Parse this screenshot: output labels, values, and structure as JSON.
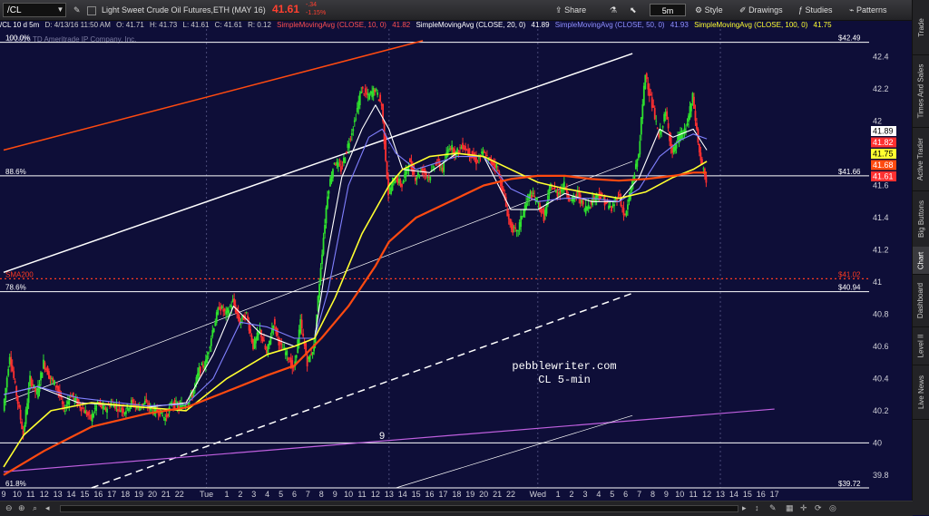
{
  "toolbar": {
    "symbol": "/CL",
    "description": "Light Sweet Crude Oil Futures,ETH (MAY 16)",
    "last_price": "41.61",
    "change_abs": "-.34",
    "change_pct": "-1.15%",
    "share": "Share",
    "timeframe": "5m",
    "style": "Style",
    "drawings": "Drawings",
    "studies": "Studies",
    "patterns": "Patterns"
  },
  "infobar": {
    "chart_id": "/CL 10 d 5m",
    "datetime": "D: 4/13/16 11:50 AM",
    "open": "O: 41.71",
    "high": "H: 41.73",
    "low": "L: 41.61",
    "close": "C: 41.61",
    "range": "R: 0.12",
    "sma10": "SimpleMovingAvg (CLOSE, 10, 0)",
    "sma10_val": "41.82",
    "sma20": "SimpleMovingAvg (CLOSE, 20, 0)",
    "sma20_val": "41.89",
    "sma50": "SimpleMovingAvg (CLOSE, 50, 0)",
    "sma50_val": "41.93",
    "sma100": "SimpleMovingAvg (CLOSE, 100, 0)",
    "sma100_val": "41.75"
  },
  "sidebar_tabs": [
    "Trade",
    "Times And Sales",
    "Active Trader",
    "Big Buttons",
    "Chart",
    "Dashboard",
    "Level II",
    "Live News"
  ],
  "colors": {
    "background": "#0e0e38",
    "sma10": "#ffffff",
    "sma20": "#8080ff",
    "sma50": "#ffff30",
    "sma100": "#ff4a10",
    "sma200": "#ff3a20",
    "fib": "#ffffff",
    "purple_line": "#c060e0",
    "candle_up": "#2ee02e",
    "candle_down": "#ff3030"
  },
  "chart_data": {
    "type": "line",
    "title": "",
    "watermark": "© 2016 TD Ameritrade IP Company, Inc.",
    "annotation_lines": [
      "pebblewriter.com",
      "CL 5-min"
    ],
    "label_9": "9",
    "yaxis": {
      "range": [
        39.72,
        42.55
      ],
      "ticks": [
        "39.8",
        "40",
        "40.2",
        "40.4",
        "40.6",
        "40.8",
        "41",
        "41.2",
        "41.4",
        "41.6",
        "41.8",
        "42",
        "42.2",
        "42.4"
      ]
    },
    "xaxis": {
      "range": [
        9,
        137
      ],
      "ticks": [
        {
          "x": 9,
          "label": "9"
        },
        {
          "x": 11,
          "label": "10"
        },
        {
          "x": 13,
          "label": "11"
        },
        {
          "x": 15,
          "label": "12"
        },
        {
          "x": 17,
          "label": "13"
        },
        {
          "x": 19,
          "label": "14"
        },
        {
          "x": 21,
          "label": "15"
        },
        {
          "x": 23,
          "label": "16"
        },
        {
          "x": 25,
          "label": "17"
        },
        {
          "x": 27,
          "label": "18"
        },
        {
          "x": 29,
          "label": "19"
        },
        {
          "x": 31,
          "label": "20"
        },
        {
          "x": 33,
          "label": "21"
        },
        {
          "x": 35,
          "label": "22"
        },
        {
          "x": 39,
          "label": "Tue"
        },
        {
          "x": 42,
          "label": "1"
        },
        {
          "x": 44,
          "label": "2"
        },
        {
          "x": 46,
          "label": "3"
        },
        {
          "x": 48,
          "label": "4"
        },
        {
          "x": 50,
          "label": "5"
        },
        {
          "x": 52,
          "label": "6"
        },
        {
          "x": 54,
          "label": "7"
        },
        {
          "x": 56,
          "label": "8"
        },
        {
          "x": 58,
          "label": "9"
        },
        {
          "x": 60,
          "label": "10"
        },
        {
          "x": 62,
          "label": "11"
        },
        {
          "x": 64,
          "label": "12"
        },
        {
          "x": 66,
          "label": "13"
        },
        {
          "x": 68,
          "label": "14"
        },
        {
          "x": 70,
          "label": "15"
        },
        {
          "x": 72,
          "label": "16"
        },
        {
          "x": 74,
          "label": "17"
        },
        {
          "x": 76,
          "label": "18"
        },
        {
          "x": 78,
          "label": "19"
        },
        {
          "x": 80,
          "label": "20"
        },
        {
          "x": 82,
          "label": "21"
        },
        {
          "x": 84,
          "label": "22"
        },
        {
          "x": 88,
          "label": "Wed"
        },
        {
          "x": 91,
          "label": "1"
        },
        {
          "x": 93,
          "label": "2"
        },
        {
          "x": 95,
          "label": "3"
        },
        {
          "x": 97,
          "label": "4"
        },
        {
          "x": 99,
          "label": "5"
        },
        {
          "x": 101,
          "label": "6"
        },
        {
          "x": 103,
          "label": "7"
        },
        {
          "x": 105,
          "label": "8"
        },
        {
          "x": 107,
          "label": "9"
        },
        {
          "x": 109,
          "label": "10"
        },
        {
          "x": 111,
          "label": "11"
        },
        {
          "x": 113,
          "label": "12"
        },
        {
          "x": 115,
          "label": "13"
        },
        {
          "x": 117,
          "label": "14"
        },
        {
          "x": 119,
          "label": "15"
        },
        {
          "x": 121,
          "label": "16"
        },
        {
          "x": 123,
          "label": "17"
        }
      ],
      "session_breaks": [
        39,
        66,
        88
      ],
      "future_breaks": [
        115
      ]
    },
    "price_path": [
      [
        9,
        40.2
      ],
      [
        10,
        40.55
      ],
      [
        11,
        40.3
      ],
      [
        12,
        40.05
      ],
      [
        13,
        40.4
      ],
      [
        14,
        40.3
      ],
      [
        15,
        40.5
      ],
      [
        16,
        40.4
      ],
      [
        17,
        40.35
      ],
      [
        18,
        40.2
      ],
      [
        19,
        40.3
      ],
      [
        20,
        40.25
      ],
      [
        21,
        40.2
      ],
      [
        22,
        40.15
      ],
      [
        23,
        40.25
      ],
      [
        24,
        40.2
      ],
      [
        25,
        40.25
      ],
      [
        26,
        40.22
      ],
      [
        27,
        40.2
      ],
      [
        28,
        40.25
      ],
      [
        29,
        40.22
      ],
      [
        30,
        40.25
      ],
      [
        31,
        40.2
      ],
      [
        32,
        40.2
      ],
      [
        33,
        40.15
      ],
      [
        34,
        40.25
      ],
      [
        35,
        40.22
      ],
      [
        36,
        40.25
      ],
      [
        37,
        40.3
      ],
      [
        38,
        40.45
      ],
      [
        39,
        40.5
      ],
      [
        40,
        40.7
      ],
      [
        41,
        40.85
      ],
      [
        42,
        40.8
      ],
      [
        43,
        40.88
      ],
      [
        44,
        40.75
      ],
      [
        45,
        40.8
      ],
      [
        46,
        40.6
      ],
      [
        47,
        40.7
      ],
      [
        48,
        40.55
      ],
      [
        49,
        40.75
      ],
      [
        50,
        40.6
      ],
      [
        51,
        40.55
      ],
      [
        52,
        40.45
      ],
      [
        53,
        40.75
      ],
      [
        54,
        40.5
      ],
      [
        55,
        40.6
      ],
      [
        56,
        41.1
      ],
      [
        57,
        41.55
      ],
      [
        58,
        41.75
      ],
      [
        59,
        41.7
      ],
      [
        60,
        41.85
      ],
      [
        61,
        42.0
      ],
      [
        62,
        42.2
      ],
      [
        63,
        42.15
      ],
      [
        64,
        42.2
      ],
      [
        65,
        42.1
      ],
      [
        66,
        41.55
      ],
      [
        67,
        41.65
      ],
      [
        68,
        41.6
      ],
      [
        69,
        41.75
      ],
      [
        70,
        41.65
      ],
      [
        71,
        41.7
      ],
      [
        72,
        41.65
      ],
      [
        73,
        41.75
      ],
      [
        74,
        41.7
      ],
      [
        75,
        41.85
      ],
      [
        76,
        41.8
      ],
      [
        77,
        41.85
      ],
      [
        78,
        41.8
      ],
      [
        79,
        41.75
      ],
      [
        80,
        41.8
      ],
      [
        81,
        41.75
      ],
      [
        82,
        41.72
      ],
      [
        83,
        41.55
      ],
      [
        84,
        41.35
      ],
      [
        85,
        41.3
      ],
      [
        86,
        41.45
      ],
      [
        87,
        41.55
      ],
      [
        88,
        41.5
      ],
      [
        89,
        41.4
      ],
      [
        90,
        41.6
      ],
      [
        91,
        41.55
      ],
      [
        92,
        41.6
      ],
      [
        93,
        41.5
      ],
      [
        94,
        41.55
      ],
      [
        95,
        41.45
      ],
      [
        96,
        41.5
      ],
      [
        97,
        41.55
      ],
      [
        98,
        41.5
      ],
      [
        99,
        41.45
      ],
      [
        100,
        41.55
      ],
      [
        101,
        41.4
      ],
      [
        102,
        41.6
      ],
      [
        103,
        41.8
      ],
      [
        104,
        42.3
      ],
      [
        105,
        42.1
      ],
      [
        106,
        41.9
      ],
      [
        107,
        42.05
      ],
      [
        108,
        41.8
      ],
      [
        109,
        41.9
      ],
      [
        110,
        41.95
      ],
      [
        111,
        42.15
      ],
      [
        112,
        41.8
      ],
      [
        113,
        41.61
      ]
    ],
    "series": [
      {
        "name": "SimpleMovingAvg (CLOSE, 10, 0)",
        "color": "#ffffff",
        "points": [
          [
            9,
            40.3
          ],
          [
            14,
            40.35
          ],
          [
            20,
            40.25
          ],
          [
            30,
            40.22
          ],
          [
            36,
            40.25
          ],
          [
            40,
            40.55
          ],
          [
            43,
            40.85
          ],
          [
            47,
            40.68
          ],
          [
            52,
            40.6
          ],
          [
            55,
            40.65
          ],
          [
            57,
            41.2
          ],
          [
            59,
            41.65
          ],
          [
            62,
            41.95
          ],
          [
            64,
            42.1
          ],
          [
            66,
            41.95
          ],
          [
            68,
            41.7
          ],
          [
            72,
            41.68
          ],
          [
            76,
            41.8
          ],
          [
            80,
            41.78
          ],
          [
            84,
            41.45
          ],
          [
            88,
            41.45
          ],
          [
            92,
            41.55
          ],
          [
            96,
            41.5
          ],
          [
            100,
            41.5
          ],
          [
            103,
            41.65
          ],
          [
            106,
            41.95
          ],
          [
            108,
            41.9
          ],
          [
            111,
            41.95
          ],
          [
            113,
            41.82
          ]
        ]
      },
      {
        "name": "SimpleMovingAvg (CLOSE, 20, 0)",
        "color": "#8080ff",
        "points": [
          [
            9,
            40.3
          ],
          [
            14,
            40.35
          ],
          [
            20,
            40.28
          ],
          [
            30,
            40.23
          ],
          [
            36,
            40.24
          ],
          [
            40,
            40.4
          ],
          [
            44,
            40.75
          ],
          [
            48,
            40.72
          ],
          [
            52,
            40.65
          ],
          [
            55,
            40.65
          ],
          [
            57,
            40.95
          ],
          [
            60,
            41.6
          ],
          [
            63,
            41.9
          ],
          [
            65,
            41.95
          ],
          [
            67,
            41.8
          ],
          [
            70,
            41.7
          ],
          [
            76,
            41.78
          ],
          [
            80,
            41.78
          ],
          [
            84,
            41.58
          ],
          [
            88,
            41.5
          ],
          [
            92,
            41.52
          ],
          [
            96,
            41.52
          ],
          [
            100,
            41.5
          ],
          [
            103,
            41.58
          ],
          [
            106,
            41.78
          ],
          [
            109,
            41.88
          ],
          [
            111,
            41.92
          ],
          [
            113,
            41.89
          ]
        ]
      },
      {
        "name": "SimpleMovingAvg (CLOSE, 50, 0)",
        "color": "#ffff30",
        "points": [
          [
            9,
            39.85
          ],
          [
            12,
            40.05
          ],
          [
            16,
            40.2
          ],
          [
            22,
            40.25
          ],
          [
            30,
            40.22
          ],
          [
            36,
            40.2
          ],
          [
            42,
            40.4
          ],
          [
            48,
            40.55
          ],
          [
            52,
            40.6
          ],
          [
            55,
            40.65
          ],
          [
            58,
            40.9
          ],
          [
            62,
            41.3
          ],
          [
            66,
            41.6
          ],
          [
            68,
            41.7
          ],
          [
            72,
            41.78
          ],
          [
            76,
            41.8
          ],
          [
            80,
            41.78
          ],
          [
            84,
            41.7
          ],
          [
            88,
            41.62
          ],
          [
            92,
            41.58
          ],
          [
            96,
            41.55
          ],
          [
            100,
            41.52
          ],
          [
            104,
            41.56
          ],
          [
            108,
            41.65
          ],
          [
            111,
            41.7
          ],
          [
            113,
            41.75
          ]
        ]
      },
      {
        "name": "SimpleMovingAvg (CLOSE, 100, 0)",
        "color": "#ff4a10",
        "points": [
          [
            9,
            39.8
          ],
          [
            15,
            39.95
          ],
          [
            22,
            40.1
          ],
          [
            30,
            40.18
          ],
          [
            36,
            40.22
          ],
          [
            42,
            40.32
          ],
          [
            48,
            40.42
          ],
          [
            52,
            40.48
          ],
          [
            56,
            40.65
          ],
          [
            60,
            40.85
          ],
          [
            64,
            41.1
          ],
          [
            66,
            41.25
          ],
          [
            70,
            41.4
          ],
          [
            76,
            41.52
          ],
          [
            80,
            41.6
          ],
          [
            84,
            41.64
          ],
          [
            88,
            41.66
          ],
          [
            92,
            41.66
          ],
          [
            96,
            41.64
          ],
          [
            100,
            41.63
          ],
          [
            104,
            41.64
          ],
          [
            108,
            41.66
          ],
          [
            111,
            41.68
          ],
          [
            113,
            41.68
          ]
        ]
      }
    ],
    "price_labels": [
      {
        "value": 41.89,
        "text": "41.89",
        "bg": "#ffffff",
        "fg": "#000000"
      },
      {
        "value": 41.82,
        "text": "41.82",
        "bg": "#ff3030",
        "fg": "#ffffff"
      },
      {
        "value": 41.75,
        "text": "41.75",
        "bg": "#ffff30",
        "fg": "#000000"
      },
      {
        "value": 41.68,
        "text": "41.68",
        "bg": "#ff4a10",
        "fg": "#ffffff"
      },
      {
        "value": 41.61,
        "text": "41.61",
        "bg": "#ff3030",
        "fg": "#ffffff"
      }
    ],
    "hlines": [
      {
        "value": 42.49,
        "label_left": "100.0%",
        "label_right": "$42.49",
        "color": "#ffffff",
        "dash": false
      },
      {
        "value": 41.66,
        "label_left": "88.6%",
        "label_right": "$41.66",
        "color": "#ffffff",
        "dash": false
      },
      {
        "value": 41.02,
        "label_left": "SMA200",
        "label_right": "$41.02",
        "color": "#ff3a20",
        "dash": true
      },
      {
        "value": 40.94,
        "label_left": "78.6%",
        "label_right": "$40.94",
        "color": "#ffffff",
        "dash": false
      },
      {
        "value": 40.0,
        "label_left": "",
        "label_right": "",
        "color": "#ffffff",
        "dash": false
      },
      {
        "value": 39.72,
        "label_left": "61.8%",
        "label_right": "$39.72",
        "color": "#ffffff",
        "dash": false
      }
    ],
    "trendlines": [
      {
        "x1": 9,
        "y1": 41.82,
        "x2": 71,
        "y2": 42.5,
        "color": "#ff4a10",
        "width": 1.5,
        "dash": false
      },
      {
        "x1": 9,
        "y1": 41.06,
        "x2": 102,
        "y2": 42.42,
        "color": "#ffffff",
        "width": 1.5,
        "dash": false
      },
      {
        "x1": 9,
        "y1": 40.25,
        "x2": 102,
        "y2": 41.75,
        "color": "#ffffff",
        "width": 0.7,
        "dash": false
      },
      {
        "x1": 22,
        "y1": 39.72,
        "x2": 102,
        "y2": 40.93,
        "color": "#ffffff",
        "width": 1.5,
        "dash": true
      },
      {
        "x1": 9,
        "y1": 39.82,
        "x2": 123,
        "y2": 40.21,
        "color": "#c060e0",
        "width": 1.2,
        "dash": false
      },
      {
        "x1": 67,
        "y1": 39.72,
        "x2": 102,
        "y2": 40.17,
        "color": "#ffffff",
        "width": 0.7,
        "dash": false
      }
    ]
  }
}
